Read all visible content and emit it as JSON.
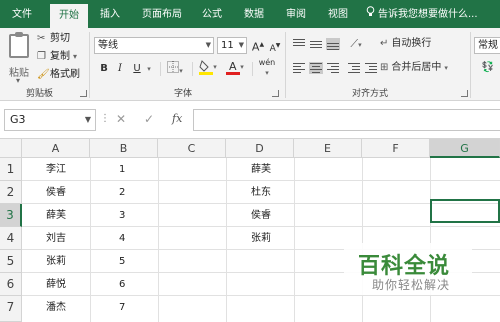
{
  "ribbon_tabs": [
    "文件",
    "开始",
    "插入",
    "页面布局",
    "公式",
    "数据",
    "审阅",
    "视图"
  ],
  "active_tab": "开始",
  "tell_me": "告诉我您想要做什么...",
  "clipboard": {
    "paste_label": "粘贴",
    "cut_label": "剪切",
    "copy_label": "复制",
    "format_painter_label": "格式刷",
    "group_label": "剪贴板"
  },
  "font": {
    "font_name": "等线",
    "font_size": "11",
    "grow_label": "A",
    "shrink_label": "A",
    "bold_label": "B",
    "italic_label": "I",
    "underline_label": "U",
    "phonetic_label": "wén",
    "group_label": "字体"
  },
  "alignment": {
    "wrap_text_label": "自动换行",
    "merge_center_label": "合并后居中",
    "group_label": "对齐方式"
  },
  "number": {
    "format_value": "常规"
  },
  "formula_bar": {
    "name_box": "G3",
    "fx_label": "fx",
    "formula": ""
  },
  "sheet": {
    "columns": [
      "A",
      "B",
      "C",
      "D",
      "E",
      "F",
      "G"
    ],
    "selected_column": "G",
    "rows": [
      "1",
      "2",
      "3",
      "4",
      "5",
      "6",
      "7"
    ],
    "selected_row": "3",
    "selected_cell": "G3",
    "col_a": [
      "李江",
      "侯睿",
      "薛芙",
      "刘吉",
      "张莉",
      "薛悦",
      "潘杰"
    ],
    "col_b": [
      "1",
      "2",
      "3",
      "4",
      "5",
      "6",
      "7"
    ],
    "col_d": [
      "薛芙",
      "杜东",
      "侯睿",
      "张莉"
    ]
  },
  "watermark": {
    "title": "百科全说",
    "subtitle": "助你轻松解决"
  },
  "colors": {
    "excel_green": "#217346",
    "ribbon_bg": "#f3f3f3",
    "header_bg": "#f3f3f3",
    "selected_header_bg": "#d3d3d3",
    "font_color_red": "#e02020",
    "highlight_yellow": "#ffe600"
  }
}
